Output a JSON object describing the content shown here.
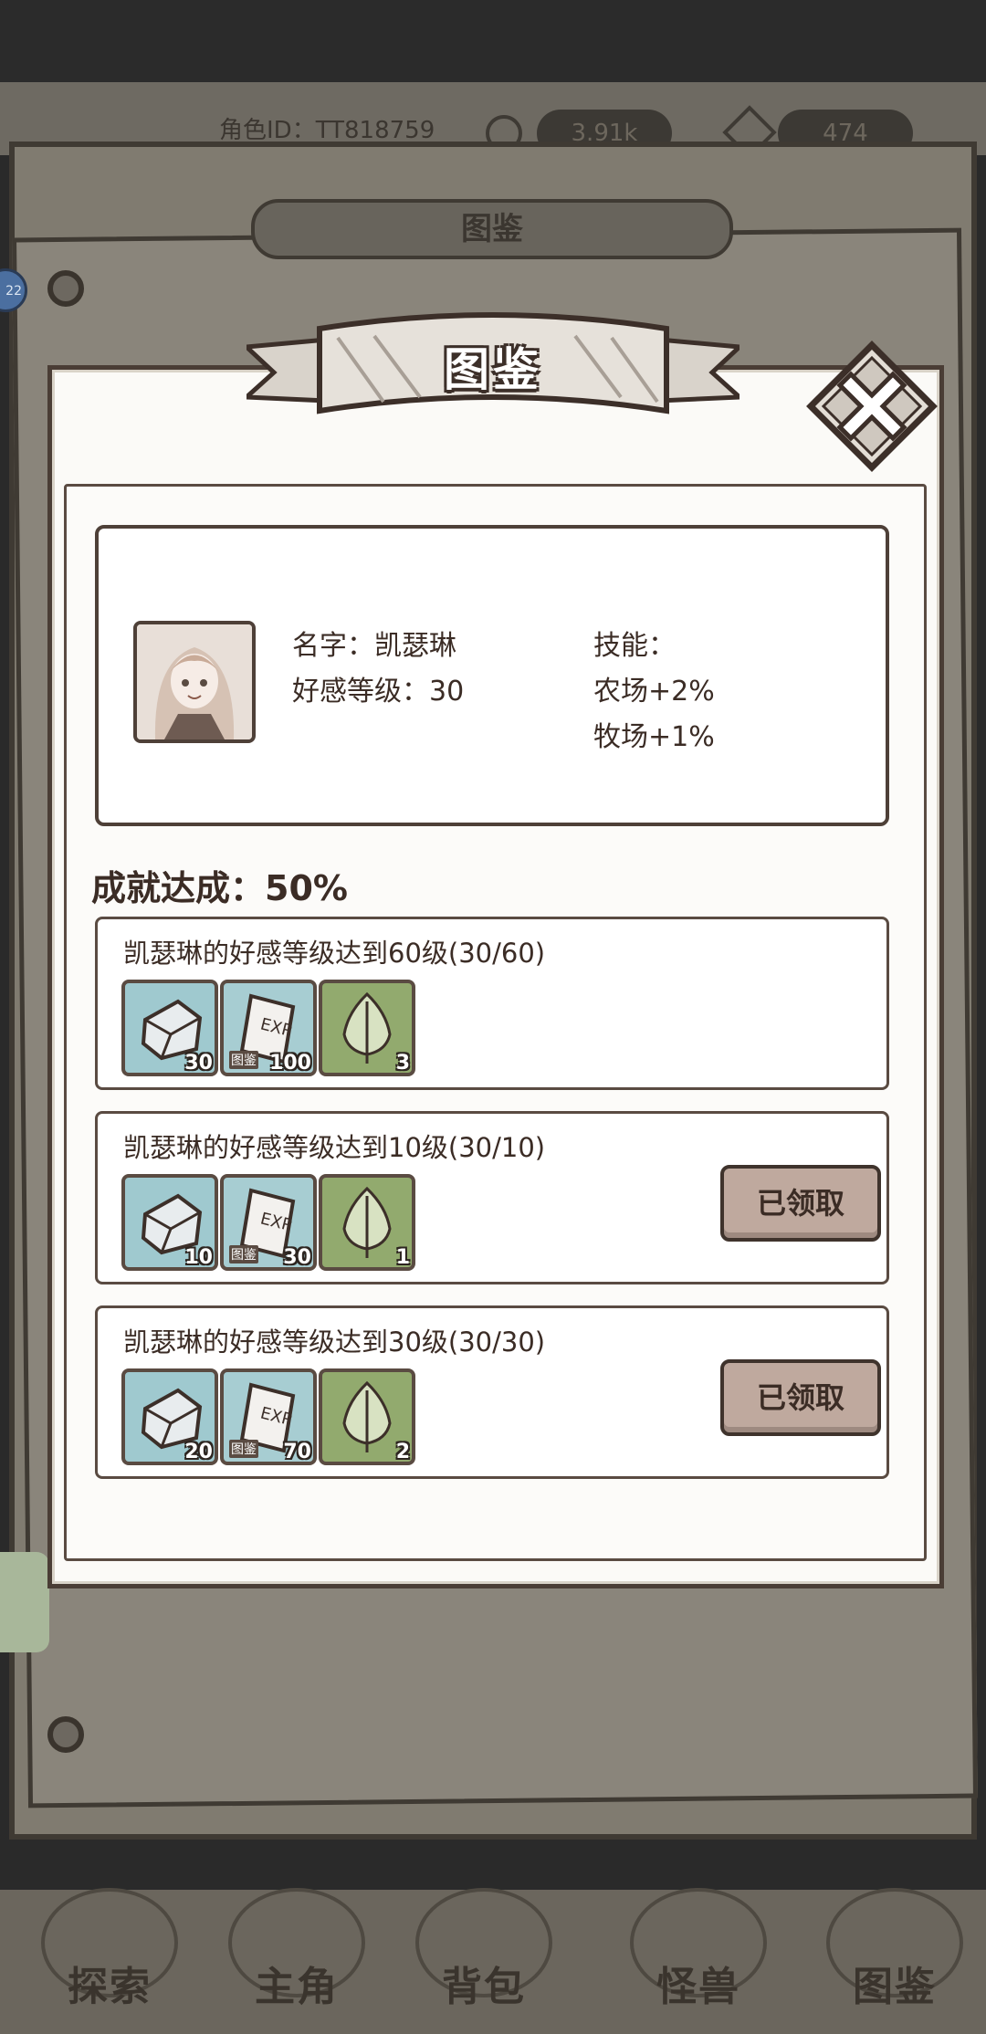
{
  "background": {
    "player_id": "角色ID：TT818759",
    "coin_value": "3.91k",
    "gem_value": "474",
    "bg_panel_title": "图鉴",
    "side_badge": "22",
    "nav": [
      "探索",
      "主角",
      "背包",
      "怪兽",
      "图鉴"
    ]
  },
  "modal": {
    "title": "图鉴",
    "close_icon": "close-x-icon",
    "character": {
      "name": "名字：凯瑟琳",
      "affinity": "好感等级：30",
      "skills_label": "技能：",
      "skills": [
        "农场+2%",
        "牧场+1%"
      ]
    },
    "achievement_progress": "成就达成：50%",
    "tasks": [
      {
        "text": "凯瑟琳的好感等级达到60级(30/60)",
        "rewards": [
          {
            "icon": "stone-icon",
            "count": "30"
          },
          {
            "icon": "exp-book-icon",
            "label": "图鉴",
            "count": "100"
          },
          {
            "icon": "leaf-icon",
            "count": "3"
          }
        ],
        "button": ""
      },
      {
        "text": "凯瑟琳的好感等级达到10级(30/10)",
        "rewards": [
          {
            "icon": "stone-icon",
            "count": "10"
          },
          {
            "icon": "exp-book-icon",
            "label": "图鉴",
            "count": "30"
          },
          {
            "icon": "leaf-icon",
            "count": "1"
          }
        ],
        "button": "已领取"
      },
      {
        "text": "凯瑟琳的好感等级达到30级(30/30)",
        "rewards": [
          {
            "icon": "stone-icon",
            "count": "20"
          },
          {
            "icon": "exp-book-icon",
            "label": "图鉴",
            "count": "70"
          },
          {
            "icon": "leaf-icon",
            "count": "2"
          }
        ],
        "button": "已领取"
      }
    ]
  },
  "colors": {
    "ink": "#3b2c25",
    "stone_bg": "#9fc9cf",
    "leaf_bg": "#92aa6e",
    "button_bg": "#bfa99e"
  }
}
